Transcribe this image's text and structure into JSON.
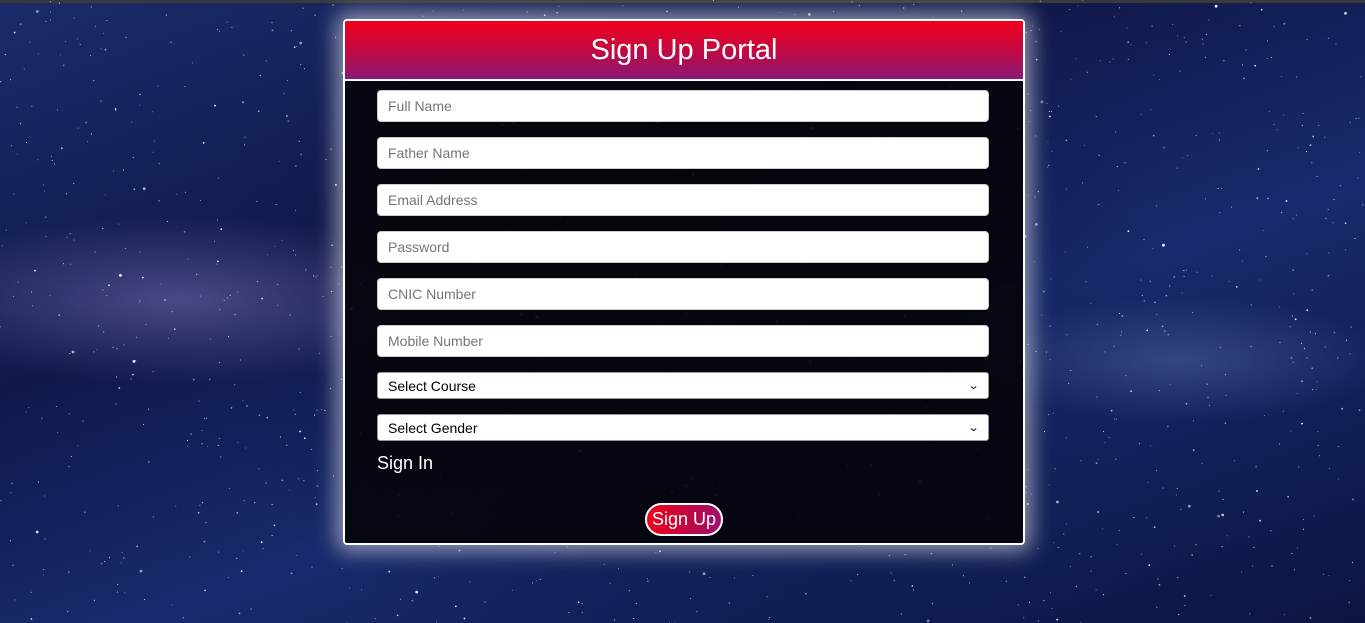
{
  "colors": {
    "header_gradient_top": "#f0001c",
    "header_gradient_bottom": "#8a1878",
    "card_background": "#04040a",
    "background": "#142360"
  },
  "header": {
    "title": "Sign Up Portal"
  },
  "form": {
    "full_name": {
      "placeholder": "Full Name"
    },
    "father_name": {
      "placeholder": "Father Name"
    },
    "email": {
      "placeholder": "Email Address"
    },
    "password": {
      "placeholder": "Password"
    },
    "cnic": {
      "placeholder": "CNIC Number"
    },
    "mobile": {
      "placeholder": "Mobile Number"
    },
    "course": {
      "selected": "Select Course",
      "icon": "chevron-down-icon"
    },
    "gender": {
      "selected": "Select Gender",
      "icon": "chevron-down-icon"
    },
    "signin_link": "Sign In",
    "signup_button": "Sign Up"
  }
}
